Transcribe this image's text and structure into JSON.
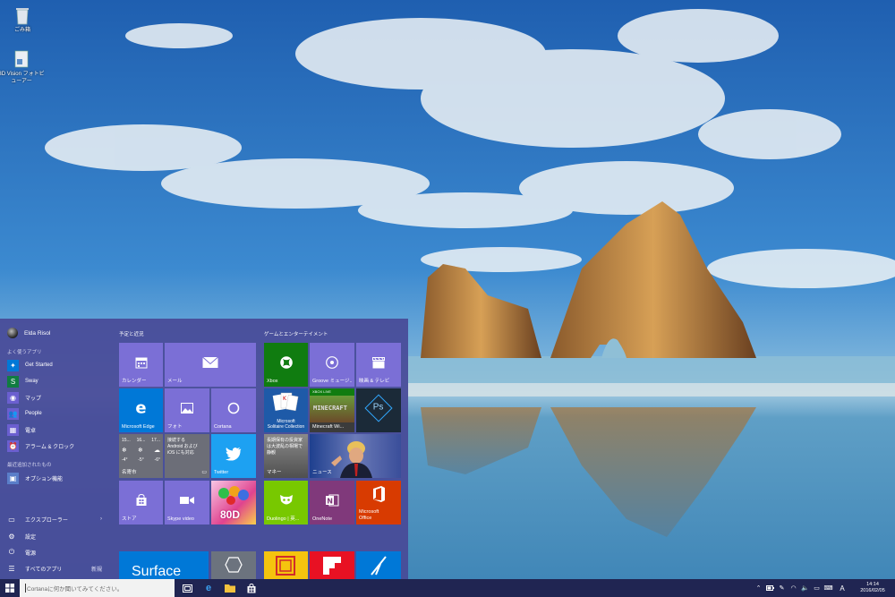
{
  "desktop": {
    "icons": [
      {
        "label": "ごみ箱"
      },
      {
        "label": "3D Vision フォトビューアー"
      }
    ]
  },
  "start_menu": {
    "user_name": "Elda Risol",
    "most_used_label": "よく使うアプリ",
    "most_used": [
      {
        "label": "Get Started",
        "icon": "lightbulb-icon",
        "color": "#0078d7"
      },
      {
        "label": "Sway",
        "icon": "sway-icon",
        "color": "#107c41"
      },
      {
        "label": "マップ",
        "icon": "map-icon",
        "color": "#6b5fd0"
      },
      {
        "label": "People",
        "icon": "people-icon",
        "color": "#6b5fd0"
      },
      {
        "label": "電卓",
        "icon": "calculator-icon",
        "color": "#6b5fd0"
      },
      {
        "label": "アラーム & クロック",
        "icon": "alarm-icon",
        "color": "#6b5fd0"
      }
    ],
    "recent_label": "最近追加されたもの",
    "recent": [
      {
        "label": "オプション機能",
        "icon": "options-icon",
        "color": "#5a7ec9"
      }
    ],
    "system": [
      {
        "label": "エクスプローラー",
        "icon": "folder-icon",
        "extra": "›"
      },
      {
        "label": "設定",
        "icon": "gear-icon",
        "extra": ""
      },
      {
        "label": "電源",
        "icon": "power-icon",
        "extra": ""
      },
      {
        "label": "すべてのアプリ",
        "icon": "list-icon",
        "extra": "新規"
      }
    ],
    "group1_label": "予定と近況",
    "group2_label": "ゲームとエンターテイメント",
    "tiles": {
      "calendar": "カレンダー",
      "mail": "メール",
      "edge": "Microsoft Edge",
      "photos": "フォト",
      "cortana": "Cortana",
      "weather_days": [
        "15...",
        "16...",
        "17..."
      ],
      "weather_temps": [
        "-4°",
        "-5°",
        "-6°"
      ],
      "weather_city": "名寄市",
      "store_promo_line1": "接続する",
      "store_promo_line2": "Android および",
      "store_promo_line3": "iOS にも対応",
      "twitter": "Twitter",
      "store": "ストア",
      "skype": "Skype video",
      "candy": "80D",
      "xbox": "Xbox",
      "groove": "Groove ミュージ...",
      "movies": "映画 & テレビ",
      "solitaire_line1": "Microsoft",
      "solitaire_line2": "Solitaire Collection",
      "minecraft_badge": "XBOX LIVE",
      "minecraft_title": "MINECRAFT",
      "minecraft_sub": "Minecraft Wi...",
      "photoshop": "Ps",
      "money_headline": "長期保有の投資家は大波乱の相場で静観",
      "money": "マネー",
      "news": "ニュース",
      "duolingo": "Duolingo | 英...",
      "onenote": "OneNote",
      "office_line1": "Microsoft",
      "office_line2": "Office",
      "surface": "Surface"
    }
  },
  "taskbar": {
    "search_placeholder": "Cortanaに何か聞いてみてください。",
    "ime_label": "A",
    "time": "14:14",
    "date": "2016/02/05"
  }
}
